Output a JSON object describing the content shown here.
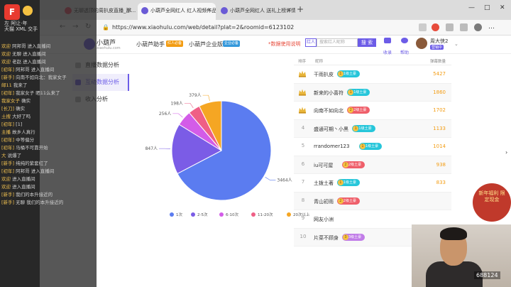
{
  "overlay": {
    "icon_text": "F",
    "header_line1": "左 阿让·年",
    "header_line2": "天猫 XML 交手",
    "chat": [
      {
        "user": "欢迎",
        "text": "阿邦哥 进入直播间"
      },
      {
        "user": "欢迎",
        "text": "无聊 进入直播间"
      },
      {
        "user": "欢迎",
        "text": "老赵 进入直播间"
      },
      {
        "user": "[初年]",
        "text": "阿邦哥 进入直播间"
      },
      {
        "user": "[新手]",
        "text": "向南不如向北：我家女子"
      },
      {
        "user": "邮11",
        "text": "我来了"
      },
      {
        "user": "[初年]",
        "text": "我家女子 晒11么来了"
      },
      {
        "user": "我家女子",
        "text": "确实"
      },
      {
        "user": "[长刀]",
        "text": "确实"
      },
      {
        "user": "土搜",
        "text": "大好了吗"
      },
      {
        "user": "[初年]",
        "text": "[1]"
      },
      {
        "user": "主播",
        "text": "故乡人真行"
      },
      {
        "user": "[初年]",
        "text": "中等偏分"
      },
      {
        "user": "[初年]",
        "text": "马桶不可靠开始"
      },
      {
        "user": "大",
        "text": "说爆了"
      },
      {
        "user": "[新手]",
        "text": "纯纯的紫套红了"
      },
      {
        "user": "[初年]",
        "text": "阿邦哥 进入直播间"
      },
      {
        "user": "欢迎",
        "text": "进入直播间"
      },
      {
        "user": "欢迎",
        "text": "进入直播间"
      },
      {
        "user": "[新手]",
        "text": "我们的本升接近的"
      },
      {
        "user": "[新手]",
        "text": "无聊 我们的本升接近的"
      }
    ]
  },
  "browser": {
    "tabs": [
      {
        "label": "无聊透顶的周扒皮直播_那...",
        "active": false
      },
      {
        "label": "小葫芦全网红人 红人视频作品...",
        "active": true
      },
      {
        "label": "小葫芦全网红人 送礼上榜详情",
        "active": false
      }
    ],
    "new_tab": "+",
    "url": "https://www.xiaohulu.com/web/detail?plat=2&roomid=6123102",
    "window_controls": [
      "—",
      "□",
      "✕"
    ]
  },
  "site": {
    "logo_text": "小葫芦",
    "logo_sub": "xiaohulu.com",
    "nav": [
      {
        "label": "小葫芦助手",
        "badge": "红人必备",
        "badge_color": "#f39c12"
      },
      {
        "label": "小葫芦企业版",
        "badge": "企业必备",
        "badge_color": "#3498db"
      }
    ],
    "data_notice": "*数据使用说明",
    "search_select": "红人",
    "search_placeholder": "搜索红人昵称",
    "search_button": "搜 索",
    "icons": [
      {
        "name": "collect",
        "label": "收录"
      },
      {
        "name": "help",
        "label": "帮助"
      }
    ],
    "user_name": "周大侠2",
    "user_badge": "营销中"
  },
  "menu": [
    {
      "label": "直播数据分析",
      "active": false,
      "icon_color": "#bbb"
    },
    {
      "label": "互动数据分析",
      "active": true,
      "icon_color": "#6c5ce7"
    },
    {
      "label": "收入分析",
      "active": false,
      "icon_color": "#bbb"
    }
  ],
  "chart_data": {
    "type": "pie",
    "title": "",
    "slices": [
      {
        "label": "1次",
        "value": 3464,
        "display": "3464人",
        "color": "#5b7cf0"
      },
      {
        "label": "2-5次",
        "value": 847,
        "display": "847人",
        "color": "#7b5ce6"
      },
      {
        "label": "6-10次",
        "value": 256,
        "display": "256人",
        "color": "#d35ce8"
      },
      {
        "label": "11-20次",
        "value": 198,
        "display": "198人",
        "color": "#ef5f86"
      },
      {
        "label": "20次以上",
        "value": 379,
        "display": "379人",
        "color": "#f5a623"
      }
    ],
    "legend_position": "bottom"
  },
  "table": {
    "headers": [
      "排序",
      "昵称",
      "弹幕数量"
    ],
    "rows": [
      {
        "rank": "1",
        "crown": true,
        "name": "干雨扒皮",
        "level": "1级土豪",
        "level_num": "1",
        "level_color": "#26c6da",
        "count": "5427"
      },
      {
        "rank": "2",
        "crown": true,
        "name": "新来的小喜符",
        "level": "1级土豪",
        "level_num": "1",
        "level_color": "#26c6da",
        "count": "1860"
      },
      {
        "rank": "3",
        "crown": true,
        "name": "向南不如向北",
        "level": "2级土豪",
        "level_num": "2",
        "level_color": "#ef5f6a",
        "count": "1702"
      },
      {
        "rank": "4",
        "crown": false,
        "name": "盛通可期丶小黑",
        "level": "1级土豪",
        "level_num": "1",
        "level_color": "#26c6da",
        "count": "1133"
      },
      {
        "rank": "5",
        "crown": false,
        "name": "rrandomer123",
        "level": "1级土豪",
        "level_num": "1",
        "level_color": "#26c6da",
        "count": "1014"
      },
      {
        "rank": "6",
        "crown": false,
        "name": "iu可可屋",
        "level": "2级土豪",
        "level_num": "2",
        "level_color": "#ef5f6a",
        "count": "938"
      },
      {
        "rank": "7",
        "crown": false,
        "name": "土拨土著",
        "level": "1级土豪",
        "level_num": "1",
        "level_color": "#26c6da",
        "count": "833"
      },
      {
        "rank": "8",
        "crown": false,
        "name": "青山初雨",
        "level": "2级土豪",
        "level_num": "2",
        "level_color": "#ef5f6a",
        "count": ""
      },
      {
        "rank": "9",
        "crown": false,
        "name": "网友小洲",
        "level": "",
        "level_num": "",
        "level_color": "",
        "count": ""
      },
      {
        "rank": "10",
        "crown": false,
        "name": "片菜不顾身",
        "level": "3级土豪",
        "level_num": "3",
        "level_color": "#c17de8",
        "count": ""
      }
    ]
  },
  "side_ad": {
    "text": "新年福利 限定现金"
  },
  "webcam": {
    "id": "688124"
  }
}
